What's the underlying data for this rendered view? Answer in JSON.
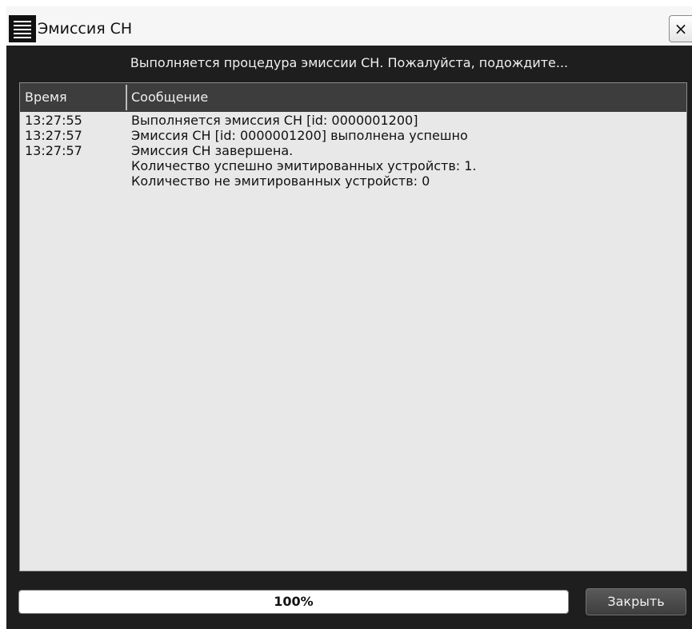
{
  "window": {
    "title": "Эмиссия СН",
    "close_glyph": "×",
    "menu_icon": "hamburger-menu-icon",
    "close_icon": "close-icon"
  },
  "status_text": "Выполняется процедура эмиссии СН. Пожалуйста, подождите...",
  "log": {
    "columns": {
      "time": "Время",
      "message": "Сообщение"
    },
    "rows": [
      {
        "time": "13:27:55",
        "message": "Выполняется эмиссия СН [id: 0000001200]"
      },
      {
        "time": "13:27:57",
        "message": "Эмиссия СН [id: 0000001200] выполнена успешно"
      },
      {
        "time": "13:27:57",
        "message": "Эмиссия СН завершена.\nКоличество успешно эмитированных устройств: 1.\nКоличество не эмитированных устройств: 0"
      }
    ]
  },
  "progress": {
    "value": 1.0,
    "label": "100%"
  },
  "footer": {
    "close_label": "Закрыть"
  },
  "colors": {
    "window_bg": "#1e1e1e",
    "titlebar_bg": "#f6f6f6",
    "log_bg": "#e8e8e8",
    "header_bg": "#3d3d3d",
    "progress_fill": "#ffffff"
  }
}
